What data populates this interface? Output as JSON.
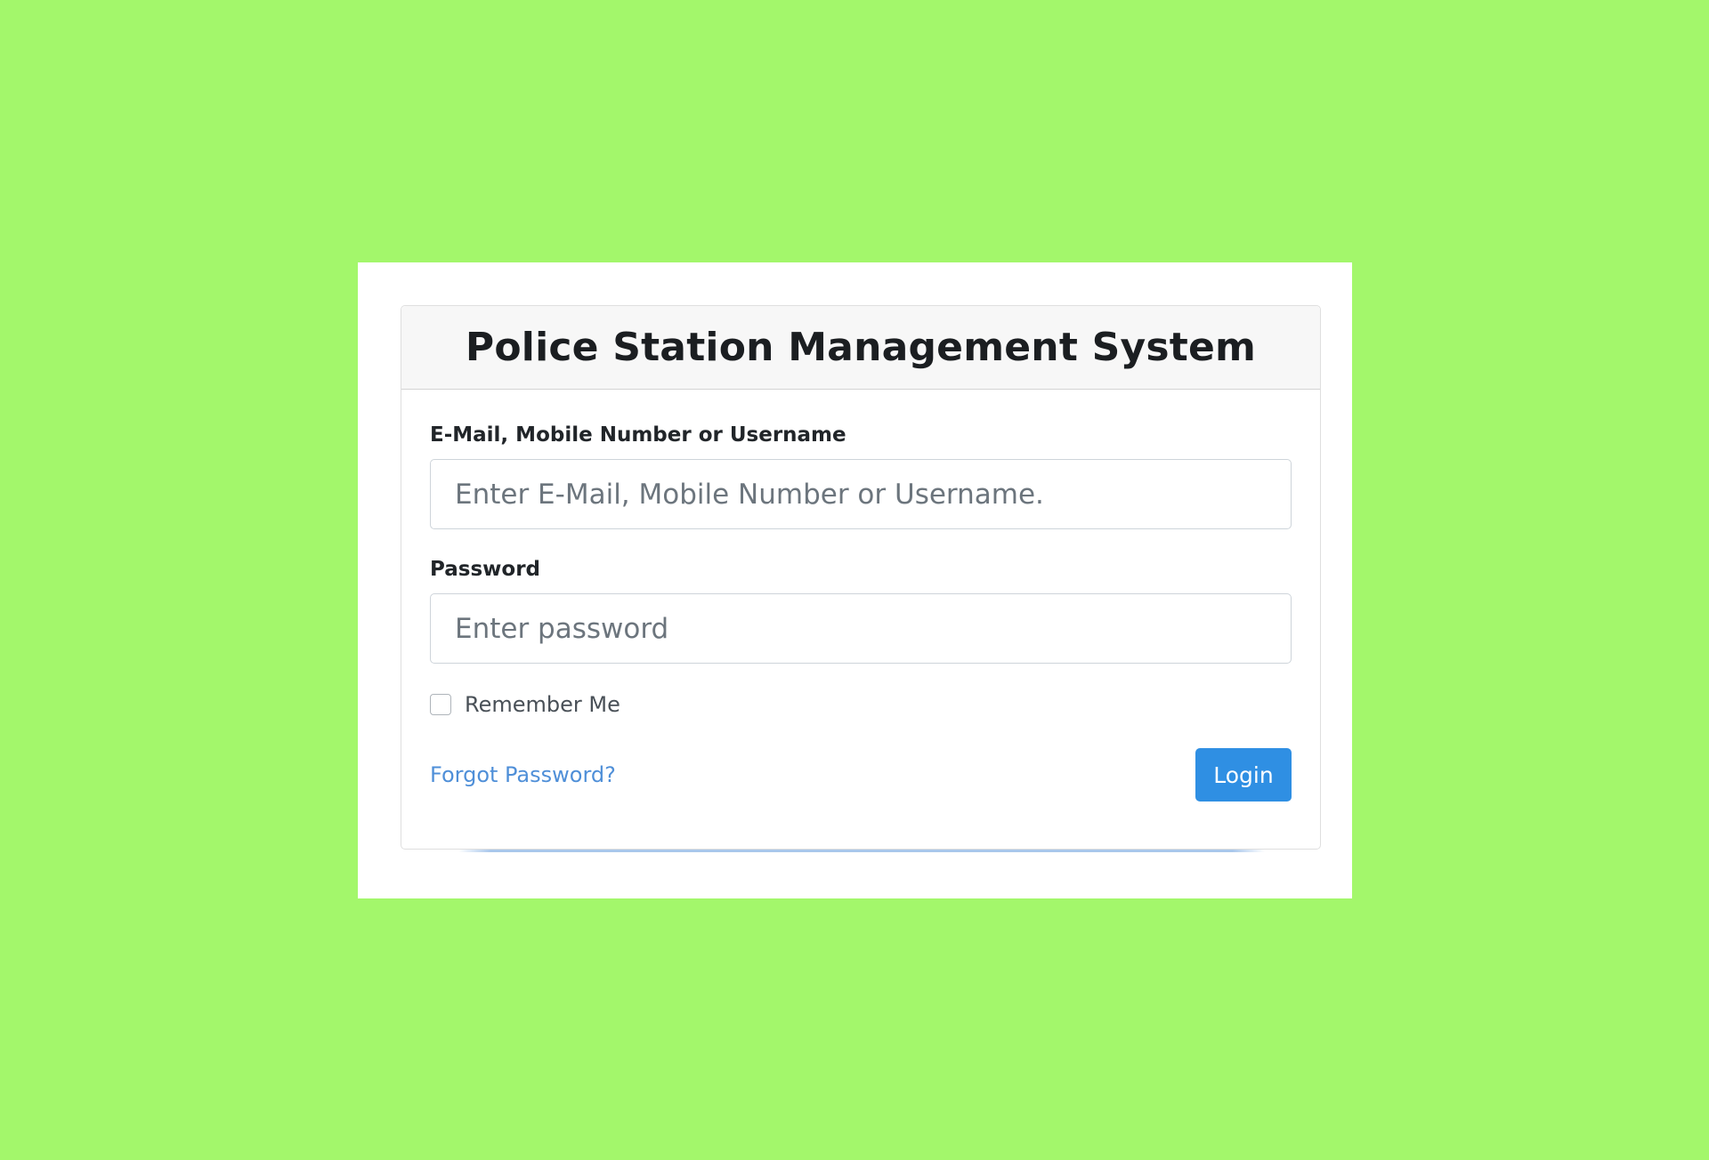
{
  "colors": {
    "background": "#a3f76b",
    "panel": "#ffffff",
    "header_bg": "#f7f7f7",
    "primary": "#2f8fe3",
    "link": "#4f8fd8"
  },
  "header": {
    "title": "Police Station Management System"
  },
  "form": {
    "email": {
      "label": "E-Mail, Mobile Number or Username",
      "placeholder": "Enter E-Mail, Mobile Number or Username.",
      "value": ""
    },
    "password": {
      "label": "Password",
      "placeholder": "Enter password",
      "value": ""
    },
    "remember": {
      "label": "Remember Me",
      "checked": false
    },
    "forgot_label": "Forgot Password?",
    "login_label": "Login"
  }
}
